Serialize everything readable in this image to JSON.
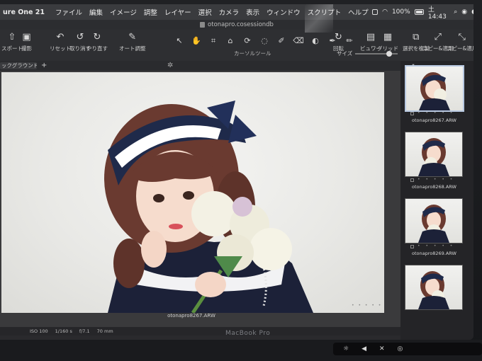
{
  "menubar": {
    "app_name": "ure One 21",
    "items": [
      "ファイル",
      "編集",
      "イメージ",
      "調整",
      "レイヤー",
      "選択",
      "カメラ",
      "表示",
      "ウィンドウ",
      "スクリプト",
      "ヘルプ"
    ],
    "battery": "100%",
    "time": "土 14:43"
  },
  "window": {
    "title": "otonapro.cosessiondb"
  },
  "toolbar": {
    "export_label": "スポート",
    "capture_label": "撮影",
    "reset_label": "リセット",
    "undo_label": "取り消す",
    "redo_label": "やり直す",
    "auto_adjust_label": "オート調整",
    "cursor_tools_label": "カーソルツール",
    "rotate_label": "回転",
    "viewer_label": "ビュワー",
    "grid_label": "グリッド",
    "select_label": "選択を複製",
    "copy_label": "コピー&適用",
    "copy_apply_label": "コピー&適用"
  },
  "subbar": {
    "layer_label": "ックグラウンド"
  },
  "viewer": {
    "filename": "otonapro8267.ARW",
    "exif": [
      "ISO 100",
      "1/160 s",
      "f/7.1",
      "70 mm"
    ]
  },
  "browser": {
    "size_label": "サイズ",
    "thumbnails": [
      {
        "name": "otonapro8267.ARW",
        "selected": true
      },
      {
        "name": "otonapro8268.ARW",
        "selected": false
      },
      {
        "name": "otonapro8269.ARW",
        "selected": false
      }
    ]
  },
  "laptop": {
    "brand": "MacBook Pro"
  },
  "colors": {
    "accent": "#ff8a2a",
    "selection": "#b8c8e0"
  }
}
